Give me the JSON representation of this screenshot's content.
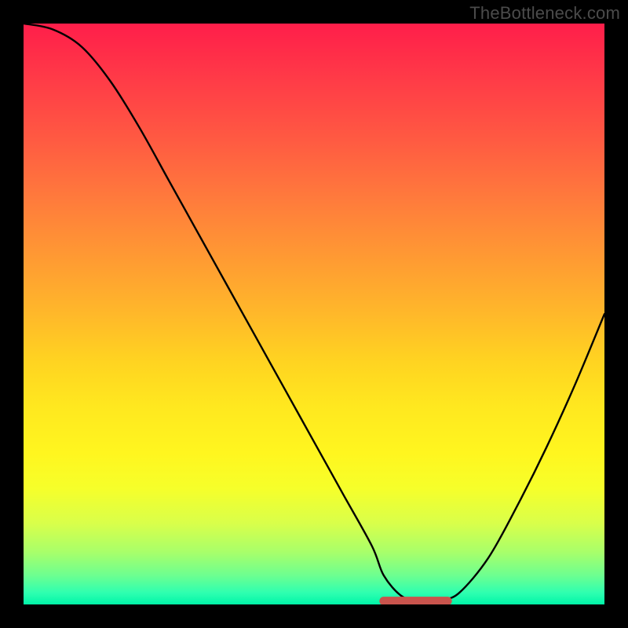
{
  "attribution": "TheBottleneck.com",
  "colors": {
    "page_bg": "#000000",
    "curve_stroke": "#000000",
    "marker_stroke": "#c9544d",
    "attribution_text": "#4b4b4b"
  },
  "chart_data": {
    "type": "line",
    "title": "",
    "xlabel": "",
    "ylabel": "",
    "xlim": [
      0,
      100
    ],
    "ylim": [
      0,
      100
    ],
    "grid": false,
    "legend": false,
    "series": [
      {
        "name": "bottleneck-curve",
        "x": [
          0,
          5,
          10,
          15,
          20,
          25,
          30,
          35,
          40,
          45,
          50,
          55,
          60,
          62,
          65,
          68,
          70,
          72,
          75,
          80,
          85,
          90,
          95,
          100
        ],
        "y": [
          100,
          99,
          96,
          90,
          82,
          73,
          64,
          55,
          46,
          37,
          28,
          19,
          10,
          5,
          1.5,
          0.5,
          0.5,
          0.8,
          2,
          8,
          17,
          27,
          38,
          50
        ]
      }
    ],
    "marker": {
      "name": "optimum-range",
      "x_start": 62,
      "x_end": 73,
      "y": 0.6
    },
    "background_gradient": {
      "type": "vertical",
      "stops": [
        {
          "pos": 0.0,
          "color": "#ff1e4a"
        },
        {
          "pos": 0.5,
          "color": "#ffb82a"
        },
        {
          "pos": 0.74,
          "color": "#fff61f"
        },
        {
          "pos": 0.91,
          "color": "#a8ff6a"
        },
        {
          "pos": 1.0,
          "color": "#00f5a8"
        }
      ]
    }
  }
}
